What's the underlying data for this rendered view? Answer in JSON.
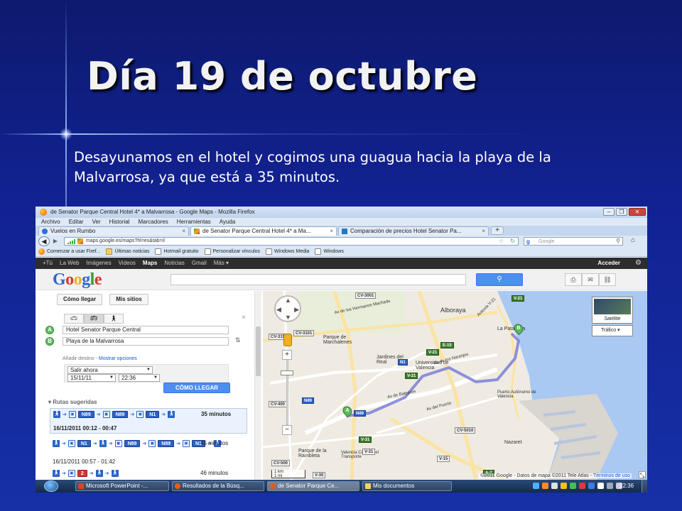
{
  "slide": {
    "title": "Día 19 de octubre",
    "body": "Desayunamos en el hotel y cogimos una guagua hacia la playa de la Malvarrosa, ya que está a 35 minutos."
  },
  "browser": {
    "window_title": "de Senator Parque Central Hotel 4* a Malvarrosa - Google Maps - Mozilla Firefox",
    "menu": [
      "Archivo",
      "Editar",
      "Ver",
      "Historial",
      "Marcadores",
      "Herramientas",
      "Ayuda"
    ],
    "tabs": [
      {
        "label": "Vuelos en Rumbo",
        "icon": "rumbo-icon"
      },
      {
        "label": "de Senator Parque Central Hotel 4* a Ma...",
        "icon": "google-maps-icon"
      },
      {
        "label": "Comparación de precios Hotel Senator Pa...",
        "icon": "trivago-icon"
      }
    ],
    "new_tab": "+",
    "url": "maps.google.es/maps?hl=es&tab=il",
    "search_placeholder": "Google",
    "bookmarks": [
      "Comenzar a usar Firef...",
      "Últimas noticias",
      "Hotmail gratuito",
      "Personalizar vínculos",
      "Windows Media",
      "Windows"
    ]
  },
  "google": {
    "nav": [
      "+Tú",
      "La Web",
      "Imágenes",
      "Videos",
      "Maps",
      "Noticias",
      "Gmail",
      "Más ▾"
    ],
    "selected_nav": "Maps",
    "signin": "Acceder",
    "logo": [
      "G",
      "o",
      "o",
      "g",
      "l",
      "e"
    ],
    "logo_colors": [
      "#3366cc",
      "#d63a2e",
      "#f0b020",
      "#3366cc",
      "#3a9a3a",
      "#d63a2e"
    ]
  },
  "panel": {
    "tabs": [
      "Cómo llegar",
      "Mis sitios"
    ],
    "close": "×",
    "modes": [
      "car-icon",
      "bus-icon",
      "walk-icon"
    ],
    "from_marker": "A",
    "to_marker": "B",
    "origin": "Hotel Senator Parque Central",
    "destination": "Playa de la Malvarrosa",
    "add_destination": "Añadir destino",
    "separator": " - ",
    "show_options": "Mostrar opciones",
    "depart_option": "Salir ahora",
    "date": "15/11/11",
    "time": "22:36",
    "go_button": "CÓMO LLEGAR",
    "routes_header": "Rutas sugeridas"
  },
  "routes": [
    {
      "lines": [
        "N89",
        "N89",
        "N1"
      ],
      "duration": "35 minutos",
      "times": "16/11/2011 00:12 - 00:47",
      "selected": true
    },
    {
      "lines": [
        "N1",
        "N89",
        "N89",
        "N1"
      ],
      "duration": "45 minutos",
      "times": "16/11/2011 00:57 - 01:42",
      "selected": false
    },
    {
      "lines": [
        "2"
      ],
      "duration": "46 minutos",
      "times": "",
      "selected": false
    }
  ],
  "map": {
    "labels": {
      "alboraya": "Alboraya",
      "la_patacona": "La Patacona",
      "parque_marchalenes": "Parque de Marchalenes",
      "jardines_real": "Jardines del Real",
      "ciudad_valencia": "Universidad de Valencia",
      "puerto_autonomo": "Puerto Autónomo de Valencia",
      "nazaret": "Nazaret",
      "parque_rambleta": "Parque de la Rambleta",
      "valencia_ciudad": "Valencia Ciudad del Transporte",
      "av_hermanos": "Av de los Hermanos Machado",
      "av_naranjos": "Av de los Naranjos",
      "av_baleares": "Av de Baleares",
      "av_puerto": "Av del Puerto",
      "autopista": "Autovía V-21"
    },
    "road_tags": [
      "CV-3001",
      "V-21",
      "CV-3101",
      "E-15",
      "V-21",
      "N1",
      "N89",
      "CV-500",
      "CV-5010",
      "V-30",
      "V-31",
      "V-15",
      "A-7",
      "CV-400",
      "CV-315",
      "V-21",
      "V-31",
      "N89"
    ],
    "marker_a": "A",
    "marker_b": "B",
    "satellite": "Satélite",
    "traffic": "Tráfico",
    "copyright": "©2011 Google - Datos de mapa ©2011 Tele Atlas -",
    "terms": "Términos de uso",
    "scale": "1 km",
    "scale_mi": "1 mi",
    "route_color": "#7b7fd6"
  },
  "taskbar": {
    "items": [
      {
        "label": "Microsoft PowerPoint -...",
        "active": false,
        "color": "#d24726"
      },
      {
        "label": "Resultados de la Búsq...",
        "active": false,
        "color": "#e85b0e"
      },
      {
        "label": "de Senator Parque Ce...",
        "active": true,
        "color": "#e85b0e"
      },
      {
        "label": "Mis documentos",
        "active": false,
        "color": "#f4cf63"
      }
    ],
    "clock": "22:36"
  }
}
